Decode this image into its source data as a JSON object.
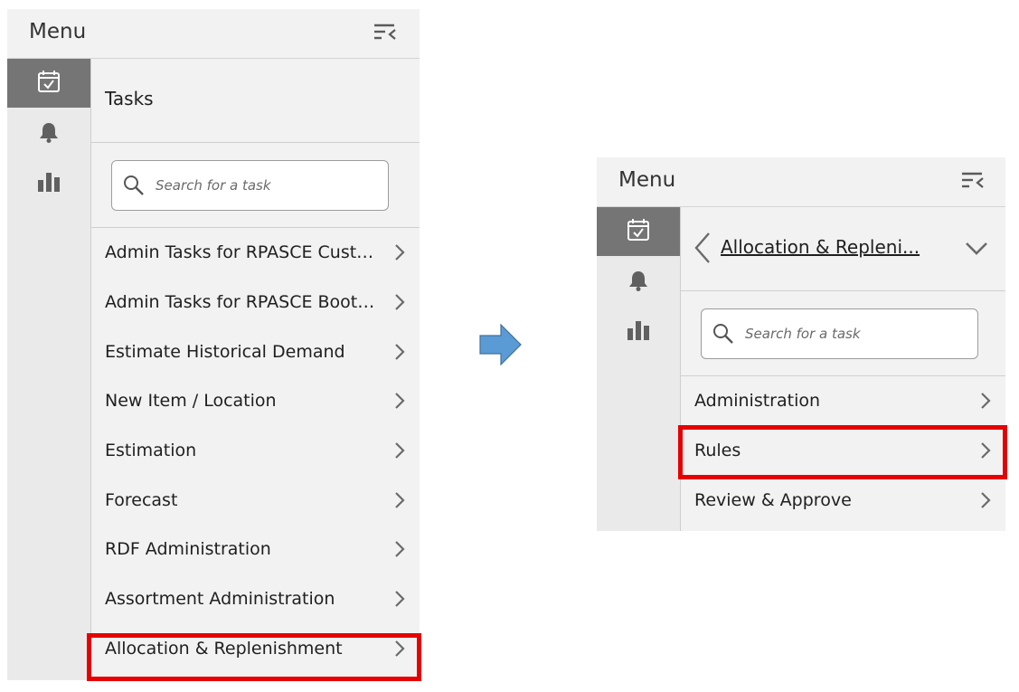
{
  "left_panel": {
    "menu_title": "Menu",
    "rail_icons": [
      "task-calendar-icon",
      "bell-icon",
      "bar-chart-icon"
    ],
    "heading": "Tasks",
    "search_placeholder": "Search for a task",
    "items": [
      "Admin Tasks for RPASCE Custom...",
      "Admin Tasks for RPASCE Bootstra...",
      "Estimate Historical Demand",
      "New Item / Location",
      "Estimation",
      "Forecast",
      "RDF Administration",
      "Assortment Administration",
      "Allocation & Replenishment"
    ],
    "highlighted_item": "Allocation & Replenishment"
  },
  "right_panel": {
    "menu_title": "Menu",
    "breadcrumb": "Allocation & Repleni...",
    "search_placeholder": "Search for a task",
    "items": [
      "Administration",
      "Rules",
      "Review & Approve"
    ],
    "highlighted_item": "Rules"
  },
  "colors": {
    "highlight": "#e60000",
    "arrow": "#5b9bd5",
    "active_rail": "#757575",
    "panel_bg": "#f2f2f2"
  }
}
